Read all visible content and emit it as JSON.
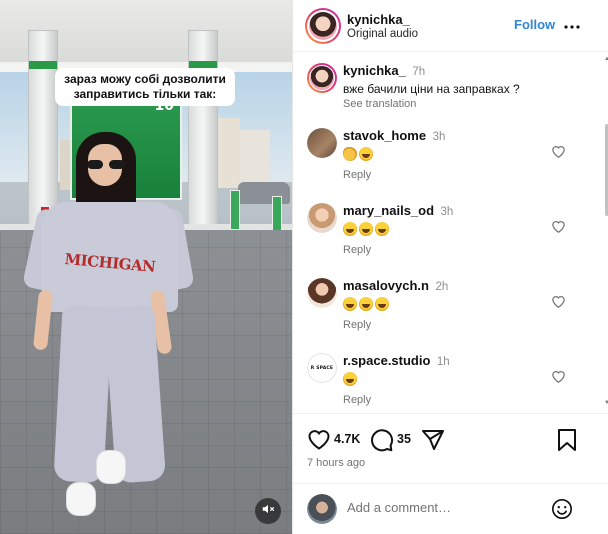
{
  "video": {
    "caption": "зараз можу собі дозволити заправитись тільки так:",
    "shirt_text": "MICHIGAN",
    "mute_icon": "speaker-muted-icon"
  },
  "header": {
    "username": "kynichka_",
    "audio": "Original audio",
    "follow_label": "Follow",
    "more_icon": "more-horizontal-icon"
  },
  "caption_post": {
    "username": "kynichka_",
    "time": "7h",
    "text": "вже бачили ціни на заправках ?",
    "see_translation": "See translation"
  },
  "comments": [
    {
      "username": "stavok_home",
      "time": "3h",
      "emojis": [
        "clap",
        "laugh"
      ],
      "reply_label": "Reply"
    },
    {
      "username": "mary_nails_od",
      "time": "3h",
      "emojis": [
        "laugh",
        "laugh",
        "laugh"
      ],
      "reply_label": "Reply"
    },
    {
      "username": "masalovych.n",
      "time": "2h",
      "emojis": [
        "laugh",
        "laugh",
        "laugh"
      ],
      "reply_label": "Reply"
    },
    {
      "username": "r.space.studio",
      "time": "1h",
      "emojis": [
        "laugh"
      ],
      "reply_label": "Reply",
      "avatar_text": "R SPACE"
    }
  ],
  "actions": {
    "likes": "4.7K",
    "comments": "35",
    "posted": "7 hours ago"
  },
  "add_comment": {
    "placeholder": "Add a comment…"
  },
  "colors": {
    "follow": "#2f86d5",
    "muted_text": "#737373"
  }
}
